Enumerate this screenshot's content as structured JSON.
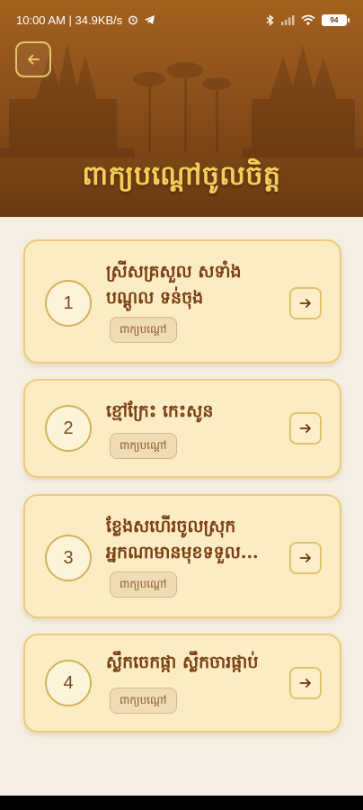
{
  "status_bar": {
    "time_speed": "10:00 AM | 34.9KB/s",
    "battery": "94"
  },
  "header": {
    "back_icon": "arrow-left-icon",
    "title": "ពាក្យបណ្ដៅចូលចិត្ត"
  },
  "items": [
    {
      "number": "1",
      "title": "ស្រីសគ្រសួល សទាំង បណ្ដូល ទន់ចុង",
      "tag": "ពាក្យបណ្ដៅ"
    },
    {
      "number": "2",
      "title": "ខ្មៅក្រែះ កេះសូន",
      "tag": "ពាក្យបណ្ដៅ"
    },
    {
      "number": "3",
      "title": "ខ្លែងសហើរចូលស្រុក អ្នកណាមានមុខទទួល...",
      "tag": "ពាក្យបណ្ដៅ"
    },
    {
      "number": "4",
      "title": "ស្លឹកចេកផ្កា ស្លឹកចារផ្កាប់",
      "tag": "ពាក្យបណ្ដៅ"
    }
  ],
  "colors": {
    "header_top": "#a4621f",
    "header_bottom": "#6b3a12",
    "title_gold": "#f3cf5a",
    "card_bg": "#fbecc4",
    "card_border": "#eacd7a"
  }
}
